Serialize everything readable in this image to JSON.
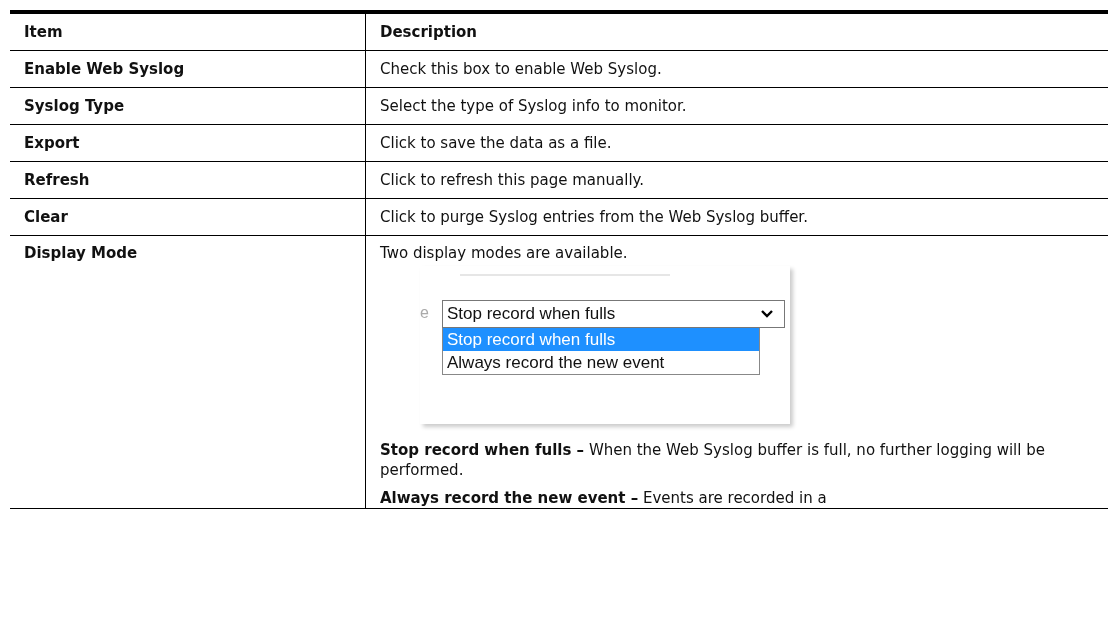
{
  "table": {
    "columns": [
      "Item",
      "Description"
    ],
    "rows": [
      {
        "item": "Enable Web Syslog",
        "description": "Check this box to enable Web Syslog."
      },
      {
        "item": "Syslog Type",
        "description": "Select the type of Syslog info to monitor."
      },
      {
        "item": "Export",
        "description": "Click to save the data as a file."
      },
      {
        "item": "Refresh",
        "description": "Click to refresh this page manually."
      },
      {
        "item": "Clear",
        "description": "Click to purge Syslog entries from the Web Syslog buffer."
      },
      {
        "item": "Display Mode",
        "description": "Two display modes are available.",
        "screenshot": {
          "label_fragment": "e",
          "select_value": "Stop record when fulls",
          "options": [
            {
              "label": "Stop record when fulls",
              "selected": true
            },
            {
              "label": "Always record the new event",
              "selected": false
            }
          ]
        },
        "notes": [
          "**Stop record when fulls –** When the Web Syslog buffer is full, no further logging will be performed.",
          "**Always record the new event –** Events are recorded in a"
        ]
      }
    ]
  }
}
